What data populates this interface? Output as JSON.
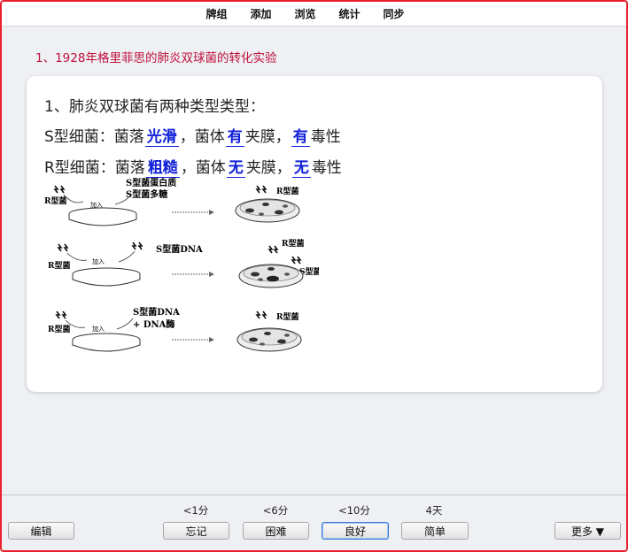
{
  "toolbar": {
    "items": [
      "牌组",
      "添加",
      "浏览",
      "统计",
      "同步"
    ]
  },
  "question": {
    "title": "1、1928年格里菲思的肺炎双球菌的转化实验"
  },
  "card": {
    "line1": "1、肺炎双球菌有两种类型类型：",
    "line2": {
      "prefix": "S型细菌：菌落",
      "a1": "光滑",
      "mid1": "，菌体",
      "a2": "有",
      "mid2": "夹膜，",
      "a3": "有",
      "suffix": "毒性"
    },
    "line3": {
      "prefix": "R型细菌：菌落",
      "a1": "粗糙",
      "mid1": "，菌体",
      "a2": "无",
      "mid2": "夹膜，",
      "a3": "无",
      "suffix": "毒性"
    },
    "figure": {
      "r_label": "R型菌",
      "add_label": "加入",
      "row1_reagent": [
        "S型菌蛋白质",
        "S型菌多糖"
      ],
      "row2_reagent": "S型菌DNA",
      "row3_reagent": [
        "S型菌DNA",
        "+ DNA酶"
      ],
      "result_r": "R型菌",
      "result_s": "S型菌"
    }
  },
  "footer": {
    "edit_label": "编辑",
    "more_label": "更多 ▼",
    "answers": [
      {
        "time": "<1分",
        "label": "忘记"
      },
      {
        "time": "<6分",
        "label": "困难"
      },
      {
        "time": "<10分",
        "label": "良好"
      },
      {
        "time": "4天",
        "label": "简单"
      }
    ]
  }
}
